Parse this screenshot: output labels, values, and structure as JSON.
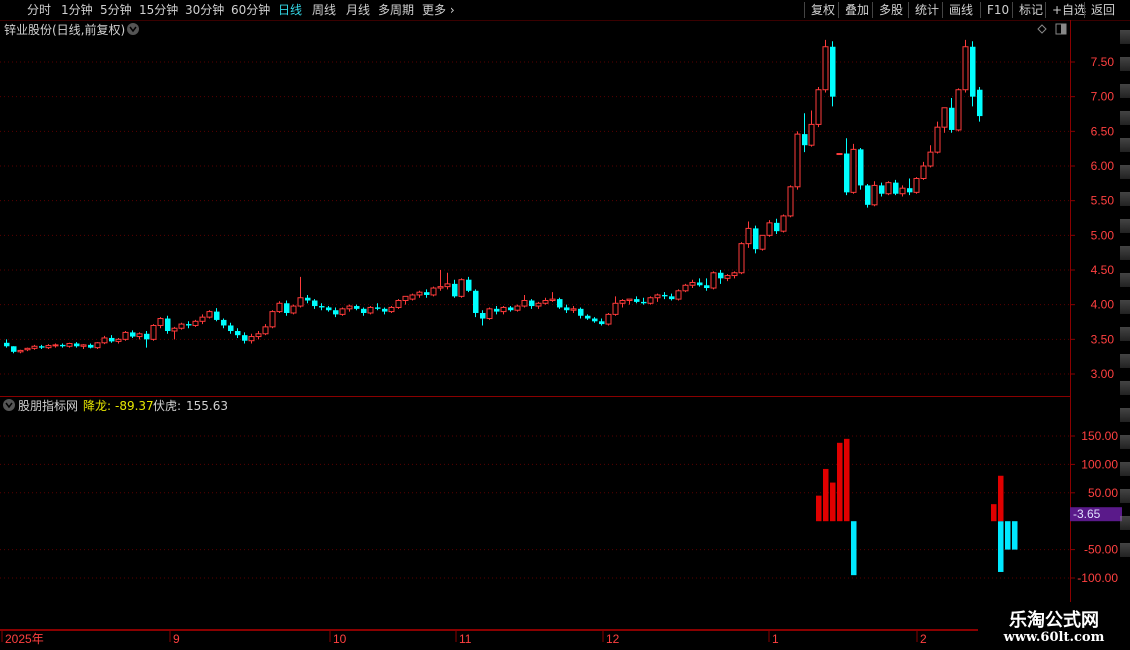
{
  "toolbar": {
    "periods": [
      {
        "label": "分时",
        "active": false
      },
      {
        "label": "1分钟",
        "active": false
      },
      {
        "label": "5分钟",
        "active": false
      },
      {
        "label": "15分钟",
        "active": false
      },
      {
        "label": "30分钟",
        "active": false
      },
      {
        "label": "60分钟",
        "active": false
      },
      {
        "label": "日线",
        "active": true
      },
      {
        "label": "周线",
        "active": false
      },
      {
        "label": "月线",
        "active": false
      },
      {
        "label": "多周期",
        "active": false
      },
      {
        "label": "更多",
        "active": false
      }
    ],
    "more_icon": "chevron-right-icon",
    "actions": [
      "复权",
      "叠加",
      "多股",
      "统计",
      "画线",
      "F10",
      "标记",
      "+自选",
      "返回"
    ]
  },
  "main_chart": {
    "title": "锌业股份(日线,前复权)",
    "title_menu_icon": "chevron-down-icon",
    "corner_icons": [
      "diamond-icon",
      "window-icon"
    ],
    "price_ticks": [
      "7.50",
      "7.00",
      "6.50",
      "6.00",
      "5.50",
      "5.00",
      "4.50",
      "4.00",
      "3.50",
      "3.00"
    ]
  },
  "indicator": {
    "menu_icon": "chevron-down-icon",
    "name": "股朋指标网",
    "line1_label": "降龙:",
    "line1_value": "-89.37",
    "line2_label": "伏虎:",
    "line2_value": "155.63",
    "ticks": [
      "150.00",
      "100.00",
      "50.00",
      "-50.00",
      "-100.00"
    ],
    "current_value": "-3.65"
  },
  "time_axis": {
    "labels": [
      "2025年",
      "9",
      "10",
      "11",
      "12",
      "1",
      "2"
    ]
  },
  "watermark": {
    "title": "乐淘公式网",
    "url": "www.60lt.com"
  },
  "colors": {
    "up": "#ff3b3b",
    "down": "#00ffff",
    "grid": "#5a0000",
    "axis_text": "#ff4040",
    "highlight": "#e6e600",
    "current_value_bg": "#5a1a8a"
  },
  "chart_data": [
    {
      "type": "candlestick",
      "title": "锌业股份(日线,前复权)",
      "ylim": [
        2.8,
        7.9
      ],
      "candles": [
        [
          3.45,
          3.5,
          3.38,
          3.4
        ],
        [
          3.4,
          3.4,
          3.3,
          3.32
        ],
        [
          3.32,
          3.35,
          3.3,
          3.34
        ],
        [
          3.35,
          3.38,
          3.33,
          3.37
        ],
        [
          3.37,
          3.42,
          3.35,
          3.4
        ],
        [
          3.4,
          3.42,
          3.36,
          3.38
        ],
        [
          3.38,
          3.43,
          3.36,
          3.41
        ],
        [
          3.41,
          3.44,
          3.38,
          3.42
        ],
        [
          3.42,
          3.44,
          3.38,
          3.4
        ],
        [
          3.4,
          3.45,
          3.38,
          3.44
        ],
        [
          3.44,
          3.46,
          3.38,
          3.4
        ],
        [
          3.4,
          3.43,
          3.36,
          3.42
        ],
        [
          3.42,
          3.44,
          3.37,
          3.38
        ],
        [
          3.38,
          3.46,
          3.36,
          3.45
        ],
        [
          3.45,
          3.55,
          3.43,
          3.52
        ],
        [
          3.52,
          3.56,
          3.45,
          3.47
        ],
        [
          3.47,
          3.52,
          3.44,
          3.5
        ],
        [
          3.5,
          3.62,
          3.48,
          3.6
        ],
        [
          3.6,
          3.63,
          3.52,
          3.54
        ],
        [
          3.54,
          3.6,
          3.5,
          3.58
        ],
        [
          3.58,
          3.62,
          3.38,
          3.5
        ],
        [
          3.5,
          3.72,
          3.48,
          3.7
        ],
        [
          3.7,
          3.82,
          3.66,
          3.8
        ],
        [
          3.8,
          3.84,
          3.58,
          3.62
        ],
        [
          3.62,
          3.68,
          3.5,
          3.66
        ],
        [
          3.66,
          3.74,
          3.64,
          3.72
        ],
        [
          3.72,
          3.76,
          3.66,
          3.7
        ],
        [
          3.7,
          3.78,
          3.68,
          3.76
        ],
        [
          3.76,
          3.86,
          3.72,
          3.82
        ],
        [
          3.82,
          3.92,
          3.8,
          3.9
        ],
        [
          3.9,
          3.95,
          3.76,
          3.78
        ],
        [
          3.78,
          3.8,
          3.66,
          3.7
        ],
        [
          3.7,
          3.74,
          3.58,
          3.62
        ],
        [
          3.62,
          3.66,
          3.52,
          3.56
        ],
        [
          3.56,
          3.6,
          3.44,
          3.48
        ],
        [
          3.48,
          3.58,
          3.44,
          3.54
        ],
        [
          3.54,
          3.62,
          3.5,
          3.58
        ],
        [
          3.58,
          3.72,
          3.56,
          3.68
        ],
        [
          3.68,
          3.92,
          3.66,
          3.9
        ],
        [
          3.9,
          4.05,
          3.88,
          4.02
        ],
        [
          4.02,
          4.06,
          3.84,
          3.88
        ],
        [
          3.88,
          4.0,
          3.86,
          3.98
        ],
        [
          3.98,
          4.4,
          3.96,
          4.1
        ],
        [
          4.1,
          4.14,
          4.02,
          4.06
        ],
        [
          4.06,
          4.08,
          3.94,
          3.98
        ],
        [
          3.98,
          4.02,
          3.92,
          3.96
        ],
        [
          3.96,
          3.98,
          3.9,
          3.92
        ],
        [
          3.92,
          3.96,
          3.82,
          3.86
        ],
        [
          3.86,
          3.96,
          3.84,
          3.94
        ],
        [
          3.94,
          4.0,
          3.9,
          3.98
        ],
        [
          3.98,
          4.0,
          3.92,
          3.94
        ],
        [
          3.94,
          3.96,
          3.84,
          3.88
        ],
        [
          3.88,
          3.98,
          3.86,
          3.96
        ],
        [
          3.96,
          4.02,
          3.92,
          3.94
        ],
        [
          3.94,
          3.96,
          3.86,
          3.9
        ],
        [
          3.9,
          3.98,
          3.88,
          3.96
        ],
        [
          3.96,
          4.08,
          3.94,
          4.06
        ],
        [
          4.06,
          4.1,
          4.0,
          4.12
        ],
        [
          4.08,
          4.16,
          4.06,
          4.14
        ],
        [
          4.14,
          4.2,
          4.1,
          4.18
        ],
        [
          4.18,
          4.22,
          4.1,
          4.14
        ],
        [
          4.14,
          4.26,
          4.12,
          4.24
        ],
        [
          4.24,
          4.5,
          4.2,
          4.26
        ],
        [
          4.26,
          4.46,
          4.22,
          4.3
        ],
        [
          4.3,
          4.36,
          4.1,
          4.12
        ],
        [
          4.12,
          4.38,
          4.1,
          4.36
        ],
        [
          4.36,
          4.4,
          4.18,
          4.2
        ],
        [
          4.2,
          4.22,
          3.82,
          3.88
        ],
        [
          3.88,
          3.92,
          3.7,
          3.8
        ],
        [
          3.8,
          3.96,
          3.78,
          3.94
        ],
        [
          3.94,
          3.98,
          3.86,
          3.9
        ],
        [
          3.9,
          3.98,
          3.86,
          3.96
        ],
        [
          3.96,
          3.98,
          3.9,
          3.92
        ],
        [
          3.92,
          4.0,
          3.9,
          3.98
        ],
        [
          3.98,
          4.14,
          3.96,
          4.06
        ],
        [
          4.06,
          4.08,
          3.94,
          3.98
        ],
        [
          3.98,
          4.04,
          3.94,
          4.02
        ],
        [
          4.02,
          4.1,
          4.0,
          4.06
        ],
        [
          4.06,
          4.18,
          4.04,
          4.08
        ],
        [
          4.08,
          4.1,
          3.94,
          3.96
        ],
        [
          3.96,
          4.0,
          3.88,
          3.92
        ],
        [
          3.92,
          3.98,
          3.88,
          3.94
        ],
        [
          3.94,
          3.96,
          3.8,
          3.84
        ],
        [
          3.84,
          3.86,
          3.78,
          3.8
        ],
        [
          3.8,
          3.82,
          3.74,
          3.76
        ],
        [
          3.76,
          3.8,
          3.7,
          3.72
        ],
        [
          3.72,
          3.88,
          3.7,
          3.86
        ],
        [
          3.86,
          4.12,
          3.84,
          4.02
        ],
        [
          4.02,
          4.08,
          3.96,
          4.06
        ],
        [
          4.06,
          4.08,
          4.0,
          4.08
        ],
        [
          4.08,
          4.12,
          4.02,
          4.04
        ],
        [
          4.04,
          4.1,
          4.0,
          4.02
        ],
        [
          4.02,
          4.12,
          4.0,
          4.1
        ],
        [
          4.1,
          4.16,
          4.04,
          4.14
        ],
        [
          4.14,
          4.18,
          4.08,
          4.12
        ],
        [
          4.12,
          4.16,
          4.06,
          4.08
        ],
        [
          4.08,
          4.22,
          4.06,
          4.2
        ],
        [
          4.2,
          4.3,
          4.18,
          4.28
        ],
        [
          4.28,
          4.36,
          4.24,
          4.32
        ],
        [
          4.32,
          4.38,
          4.26,
          4.28
        ],
        [
          4.28,
          4.38,
          4.2,
          4.24
        ],
        [
          4.24,
          4.48,
          4.22,
          4.46
        ],
        [
          4.46,
          4.5,
          4.3,
          4.38
        ],
        [
          4.38,
          4.44,
          4.34,
          4.42
        ],
        [
          4.42,
          4.48,
          4.38,
          4.46
        ],
        [
          4.46,
          4.9,
          4.44,
          4.88
        ],
        [
          4.88,
          5.2,
          4.82,
          5.1
        ],
        [
          5.1,
          5.14,
          4.74,
          4.8
        ],
        [
          4.8,
          5.0,
          4.78,
          5.0
        ],
        [
          5.0,
          5.22,
          4.98,
          5.18
        ],
        [
          5.18,
          5.24,
          5.02,
          5.06
        ],
        [
          5.06,
          5.3,
          5.04,
          5.28
        ],
        [
          5.28,
          5.72,
          5.26,
          5.7
        ],
        [
          5.7,
          6.5,
          5.66,
          6.46
        ],
        [
          6.46,
          6.76,
          6.2,
          6.3
        ],
        [
          6.3,
          6.8,
          6.28,
          6.6
        ],
        [
          6.6,
          7.14,
          6.56,
          7.1
        ],
        [
          7.1,
          7.82,
          7.06,
          7.72
        ],
        [
          7.72,
          7.8,
          6.86,
          7.0
        ],
        [
          6.18,
          6.18,
          6.18,
          6.18
        ],
        [
          6.18,
          6.4,
          5.58,
          5.62
        ],
        [
          5.62,
          6.32,
          5.6,
          6.24
        ],
        [
          6.24,
          6.26,
          5.66,
          5.72
        ],
        [
          5.72,
          5.74,
          5.4,
          5.44
        ],
        [
          5.44,
          5.78,
          5.42,
          5.72
        ],
        [
          5.72,
          5.76,
          5.56,
          5.6
        ],
        [
          5.6,
          5.78,
          5.58,
          5.76
        ],
        [
          5.76,
          5.8,
          5.58,
          5.6
        ],
        [
          5.6,
          5.72,
          5.56,
          5.68
        ],
        [
          5.68,
          5.82,
          5.58,
          5.62
        ],
        [
          5.62,
          5.84,
          5.6,
          5.82
        ],
        [
          5.82,
          6.06,
          5.8,
          6.0
        ],
        [
          6.0,
          6.3,
          5.98,
          6.2
        ],
        [
          6.2,
          6.64,
          6.18,
          6.56
        ],
        [
          6.56,
          6.7,
          6.48,
          6.84
        ],
        [
          6.84,
          6.98,
          6.48,
          6.52
        ],
        [
          6.52,
          7.12,
          6.5,
          7.1
        ],
        [
          7.1,
          7.82,
          7.06,
          7.72
        ],
        [
          7.72,
          7.8,
          6.86,
          7.0
        ],
        [
          7.1,
          7.14,
          6.64,
          6.72
        ]
      ]
    },
    {
      "type": "bar",
      "series": [
        {
          "name": "降龙",
          "values": [
            0,
            0,
            0,
            0,
            0,
            0,
            0,
            0,
            0,
            0,
            0,
            0,
            0,
            0,
            0,
            0,
            0,
            0,
            0,
            0,
            0,
            0,
            0,
            0,
            0,
            0,
            0,
            0,
            0,
            0,
            0,
            0,
            0,
            0,
            0,
            0,
            0,
            0,
            0,
            0,
            0,
            0,
            0,
            0,
            0,
            0,
            0,
            0,
            0,
            0,
            0,
            0,
            0,
            0,
            0,
            0,
            0,
            0,
            0,
            0,
            0,
            0,
            0,
            0,
            0,
            0,
            0,
            0,
            0,
            0,
            0,
            0,
            0,
            0,
            0,
            0,
            0,
            0,
            0,
            0,
            0,
            0,
            0,
            0,
            0,
            0,
            0,
            0,
            0,
            0,
            0,
            0,
            0,
            0,
            0,
            0,
            0,
            0,
            0,
            0,
            0,
            0,
            0,
            0,
            0,
            0,
            0,
            0,
            0,
            0,
            0,
            0,
            0,
            0,
            0,
            0,
            45,
            92,
            68,
            138,
            145,
            0,
            0,
            0,
            0,
            0,
            0,
            0,
            0,
            0,
            0,
            0,
            0,
            0,
            0,
            0,
            0,
            0,
            0,
            0,
            0,
            30,
            -89.37,
            0,
            0,
            0,
            0
          ]
        },
        {
          "name": "伏虎",
          "values": [
            0,
            0,
            0,
            0,
            0,
            0,
            0,
            0,
            0,
            0,
            0,
            0,
            0,
            0,
            0,
            0,
            0,
            0,
            0,
            0,
            0,
            0,
            0,
            0,
            0,
            0,
            0,
            0,
            0,
            0,
            0,
            0,
            0,
            0,
            0,
            0,
            0,
            0,
            0,
            0,
            0,
            0,
            0,
            0,
            0,
            0,
            0,
            0,
            0,
            0,
            0,
            0,
            0,
            0,
            0,
            0,
            0,
            0,
            0,
            0,
            0,
            0,
            0,
            0,
            0,
            0,
            0,
            0,
            0,
            0,
            0,
            0,
            0,
            0,
            0,
            0,
            0,
            0,
            0,
            0,
            0,
            0,
            0,
            0,
            0,
            0,
            0,
            0,
            0,
            0,
            0,
            0,
            0,
            0,
            0,
            0,
            0,
            0,
            0,
            0,
            0,
            0,
            0,
            0,
            0,
            0,
            0,
            0,
            0,
            0,
            0,
            0,
            0,
            0,
            0,
            0,
            0,
            0,
            0,
            0,
            0,
            -95,
            0,
            0,
            0,
            0,
            0,
            0,
            0,
            0,
            0,
            0,
            0,
            0,
            0,
            0,
            0,
            0,
            0,
            0,
            0,
            0,
            80,
            -50,
            -50,
            0,
            0
          ]
        }
      ],
      "ylim": [
        -120,
        170
      ]
    }
  ]
}
